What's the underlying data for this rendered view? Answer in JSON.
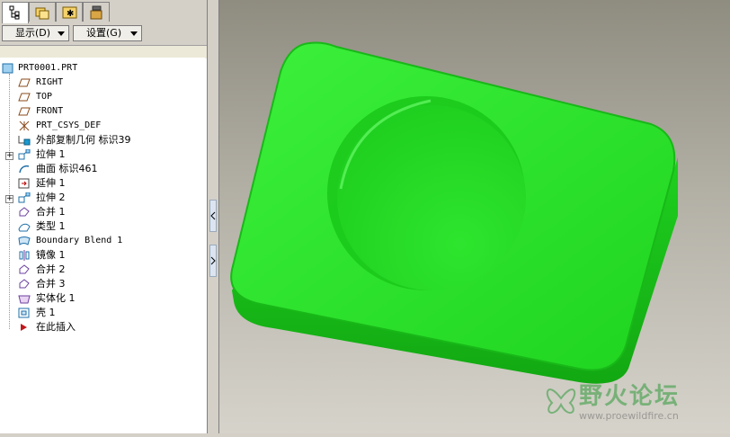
{
  "toolbar": {
    "show_label": "显示(D)",
    "settings_label": "设置(G)"
  },
  "tree": {
    "items": [
      {
        "label": "PRT0001.PRT",
        "icon": "part-icon"
      },
      {
        "label": "RIGHT",
        "icon": "datum-plane-icon"
      },
      {
        "label": "TOP",
        "icon": "datum-plane-icon"
      },
      {
        "label": "FRONT",
        "icon": "datum-plane-icon"
      },
      {
        "label": "PRT_CSYS_DEF",
        "icon": "coordinate-system-icon"
      },
      {
        "label": "外部复制几何 标识39",
        "icon": "external-copy-geometry-icon"
      },
      {
        "label": "拉伸 1",
        "icon": "extrude-icon"
      },
      {
        "label": "曲面 标识461",
        "icon": "surface-icon"
      },
      {
        "label": "延伸 1",
        "icon": "extend-icon"
      },
      {
        "label": "拉伸 2",
        "icon": "extrude-icon"
      },
      {
        "label": "合并 1",
        "icon": "merge-icon"
      },
      {
        "label": "类型 1",
        "icon": "type-icon"
      },
      {
        "label": "Boundary Blend 1",
        "icon": "boundary-blend-icon"
      },
      {
        "label": "镜像 1",
        "icon": "mirror-icon"
      },
      {
        "label": "合并 2",
        "icon": "merge-icon"
      },
      {
        "label": "合并 3",
        "icon": "merge-icon"
      },
      {
        "label": "实体化 1",
        "icon": "solidify-icon"
      },
      {
        "label": "壳 1",
        "icon": "shell-icon"
      },
      {
        "label": "在此插入",
        "icon": "insert-here-arrow-icon"
      }
    ]
  },
  "viewport": {
    "model_color": "#22dd22",
    "watermark_title": "野火论坛",
    "watermark_url": "www.proewildfire.cn"
  }
}
